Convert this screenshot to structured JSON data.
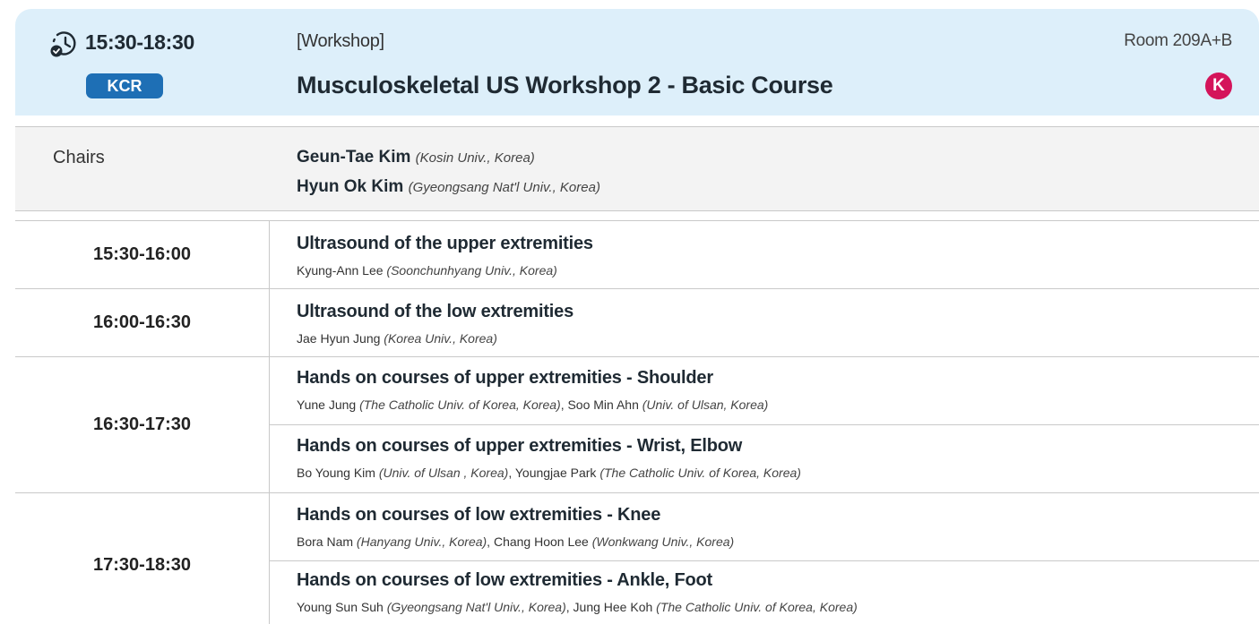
{
  "header": {
    "time": "15:30-18:30",
    "org_badge": "KCR",
    "session_type": "[Workshop]",
    "title": "Musculoskeletal US Workshop 2 - Basic Course",
    "room": "Room 209A+B",
    "lang_badge": "K",
    "clock_icon": "clock-check-icon"
  },
  "chairs": {
    "label": "Chairs",
    "people": [
      {
        "name": "Geun-Tae Kim",
        "affil": "(Kosin Univ., Korea)"
      },
      {
        "name": "Hyun Ok Kim",
        "affil": "(Gyeongsang Nat'l Univ., Korea)"
      }
    ]
  },
  "schedule": [
    {
      "time": "15:30-16:00",
      "talks": [
        {
          "title": "Ultrasound of the upper extremities",
          "s1": "Kyung-Ann Lee",
          "a1": "(Soonchunhyang Univ., Korea)"
        }
      ]
    },
    {
      "time": "16:00-16:30",
      "talks": [
        {
          "title": "Ultrasound of the low extremities",
          "s1": "Jae Hyun Jung",
          "a1": "(Korea Univ., Korea)"
        }
      ]
    },
    {
      "time": "16:30-17:30",
      "talks": [
        {
          "title": "Hands on courses of upper extremities - Shoulder",
          "s1": "Yune Jung",
          "a1": "(The Catholic Univ. of Korea, Korea)",
          "s2": "Soo Min Ahn",
          "a2": "(Univ. of Ulsan, Korea)"
        },
        {
          "title": "Hands on courses of upper extremities - Wrist, Elbow",
          "s1": "Bo Young Kim",
          "a1": "(Univ. of Ulsan , Korea)",
          "s2": "Youngjae Park",
          "a2": "(The Catholic Univ. of Korea, Korea)"
        }
      ]
    },
    {
      "time": "17:30-18:30",
      "talks": [
        {
          "title": "Hands on courses of low extremities - Knee",
          "s1": "Bora Nam",
          "a1": "(Hanyang Univ., Korea)",
          "s2": "Chang Hoon Lee",
          "a2": "(Wonkwang Univ., Korea)"
        },
        {
          "title": "Hands on courses of low extremities - Ankle, Foot",
          "s1": "Young Sun Suh",
          "a1": "(Gyeongsang Nat'l Univ., Korea)",
          "s2": "Jung Hee Koh",
          "a2": "(The Catholic Univ. of Korea, Korea)"
        }
      ]
    }
  ],
  "colors": {
    "header_bg": "#ddeffa",
    "org_badge": "#1e6fb5",
    "lang_badge": "#d4145a",
    "chairs_bg": "#f3f3f3"
  }
}
